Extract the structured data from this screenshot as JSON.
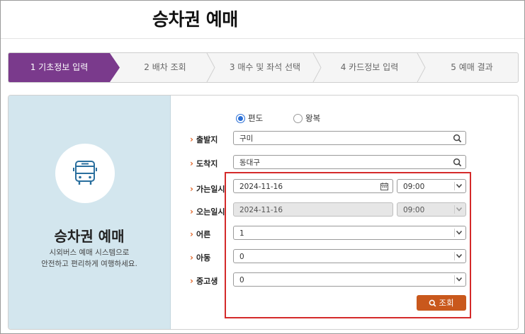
{
  "page": {
    "title": "승차권 예매"
  },
  "steps": [
    {
      "label": "1 기초정보 입력",
      "active": true
    },
    {
      "label": "2 배차 조회",
      "active": false
    },
    {
      "label": "3 매수 및 좌석 선택",
      "active": false
    },
    {
      "label": "4 카드정보 입력",
      "active": false
    },
    {
      "label": "5 예매 결과",
      "active": false
    }
  ],
  "left": {
    "icon": "bus-icon",
    "title": "승차권 예매",
    "desc_line1": "시외버스 예매 시스템으로",
    "desc_line2": "안전하고 편리하게 여행하세요."
  },
  "trip": {
    "one_way": "편도",
    "round_trip": "왕복",
    "selected": "편도"
  },
  "form": {
    "departure": {
      "label": "출발지",
      "value": "구미"
    },
    "arrival": {
      "label": "도착지",
      "value": "동대구"
    },
    "go_date": {
      "label": "가는일시",
      "date": "2024-11-16",
      "time": "09:00"
    },
    "return_date": {
      "label": "오는일시",
      "date": "2024-11-16",
      "time": "09:00"
    },
    "adult": {
      "label": "어른",
      "value": "1"
    },
    "child": {
      "label": "아동",
      "value": "0"
    },
    "student": {
      "label": "중고생",
      "value": "0"
    },
    "search_label": "조회"
  },
  "colors": {
    "active_step": "#7a3a8c",
    "left_panel": "#d3e6ee",
    "accent_arrow": "#e0662a",
    "search_button": "#c9581c",
    "highlight_box": "#d42a2a",
    "radio_selected": "#2a6fd6"
  }
}
